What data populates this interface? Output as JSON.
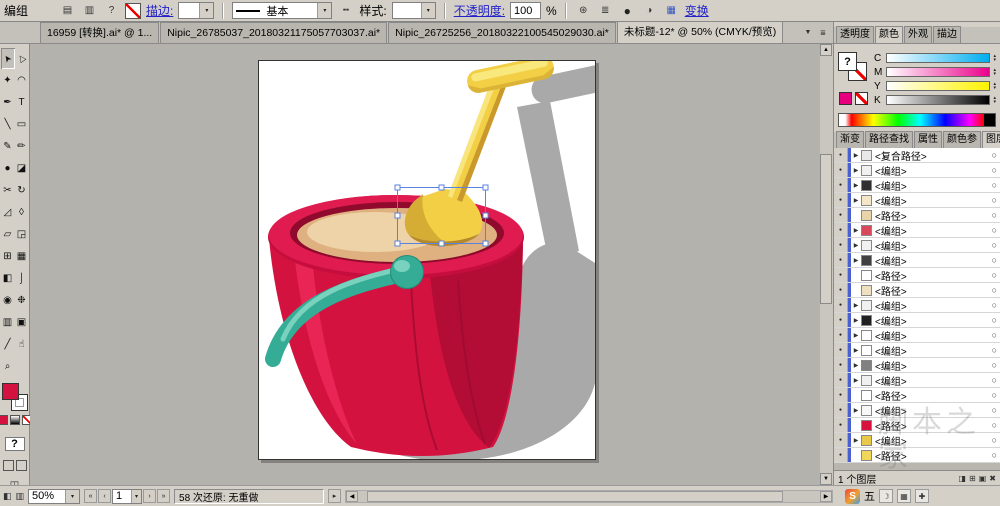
{
  "control_bar": {
    "object_label": "编组",
    "help": "?",
    "stroke_link": "描边:",
    "brush_definition": "基本",
    "style_label": "样式:",
    "opacity_link": "不透明度:",
    "opacity_value": "100",
    "percent": "%",
    "transform_link": "变换"
  },
  "document_tabs": {
    "tabs": [
      {
        "label": "16959 [转换].ai* @ 1...",
        "active": false
      },
      {
        "label": "Nipic_26785037_20180321175057703037.ai*",
        "active": false
      },
      {
        "label": "Nipic_26725256_20180322100545029030.ai*",
        "active": false
      },
      {
        "label": "未标题-12* @ 50% (CMYK/预览)",
        "active": true
      }
    ]
  },
  "toolbar": {
    "help_glyph": "?",
    "tools": [
      {
        "name": "selection-tool",
        "glyph": "➤",
        "rot": true
      },
      {
        "name": "direct-selection-tool",
        "glyph": "▷",
        "rot": true
      },
      {
        "name": "magic-wand-tool",
        "glyph": "✦"
      },
      {
        "name": "lasso-tool",
        "glyph": "◠"
      },
      {
        "name": "pen-tool",
        "glyph": "✒"
      },
      {
        "name": "type-tool",
        "glyph": "T"
      },
      {
        "name": "line-segment-tool",
        "glyph": "╲"
      },
      {
        "name": "rectangle-tool",
        "glyph": "▭"
      },
      {
        "name": "paintbrush-tool",
        "glyph": "✎"
      },
      {
        "name": "pencil-tool",
        "glyph": "✏"
      },
      {
        "name": "blob-brush-tool",
        "glyph": "●"
      },
      {
        "name": "eraser-tool",
        "glyph": "◪"
      },
      {
        "name": "scissors-tool",
        "glyph": "✂"
      },
      {
        "name": "rotate-tool",
        "glyph": "↻"
      },
      {
        "name": "scale-tool",
        "glyph": "◿"
      },
      {
        "name": "width-tool",
        "glyph": "◊"
      },
      {
        "name": "free-transform-tool",
        "glyph": "▱"
      },
      {
        "name": "shape-builder-tool",
        "glyph": "◲"
      },
      {
        "name": "perspective-grid-tool",
        "glyph": "⊞"
      },
      {
        "name": "mesh-tool",
        "glyph": "▦"
      },
      {
        "name": "gradient-tool",
        "glyph": "◧"
      },
      {
        "name": "eyedropper-tool",
        "glyph": "⌡"
      },
      {
        "name": "blend-tool",
        "glyph": "◉"
      },
      {
        "name": "symbol-sprayer-tool",
        "glyph": "❉"
      },
      {
        "name": "column-graph-tool",
        "glyph": "▥"
      },
      {
        "name": "artboard-tool",
        "glyph": "▣"
      },
      {
        "name": "slice-tool",
        "glyph": "╱"
      },
      {
        "name": "hand-tool",
        "glyph": "☝"
      },
      {
        "name": "zoom-tool",
        "glyph": "⌕"
      }
    ]
  },
  "right_dock": {
    "panel_tabs_top": {
      "tabs": [
        {
          "label": "透明度",
          "name": "tab-transparency",
          "active": false
        },
        {
          "label": "颜色",
          "name": "tab-color",
          "active": true
        },
        {
          "label": "外观",
          "name": "tab-appearance",
          "active": false
        },
        {
          "label": "描边",
          "name": "tab-stroke",
          "active": false
        }
      ]
    },
    "color_panel": {
      "fill_unknown": "?",
      "channels": [
        {
          "label": "C",
          "from": "#ffffff",
          "to": "#00aeef"
        },
        {
          "label": "M",
          "from": "#ffffff",
          "to": "#ec008c"
        },
        {
          "label": "Y",
          "from": "#ffffff",
          "to": "#fff200"
        },
        {
          "label": "K",
          "from": "#ffffff",
          "to": "#000000"
        }
      ],
      "last_color": "#e6007e"
    },
    "panel_tabs_mid": {
      "tabs": [
        {
          "label": "渐变",
          "name": "tab-gradient",
          "active": false
        },
        {
          "label": "路径查找",
          "name": "tab-pathfinder",
          "active": false
        },
        {
          "label": "属性",
          "name": "tab-attributes",
          "active": false
        },
        {
          "label": "颜色参",
          "name": "tab-color-guide",
          "active": false
        },
        {
          "label": "图层",
          "name": "tab-layers",
          "active": true
        }
      ]
    },
    "layers_panel": {
      "status": "1 个图层",
      "rows": [
        {
          "label": "<复合路径>",
          "thumb": "#e8e8e8",
          "group": true
        },
        {
          "label": "<编组>",
          "thumb": "#f0f0f0",
          "group": true
        },
        {
          "label": "<编组>",
          "thumb": "#303030",
          "group": true
        },
        {
          "label": "<编组>",
          "thumb": "#f5e6c8",
          "group": true
        },
        {
          "label": "<路径>",
          "thumb": "#e9d3a8",
          "group": false
        },
        {
          "label": "<编组>",
          "thumb": "#d84a5a",
          "group": true
        },
        {
          "label": "<编组>",
          "thumb": "#f0f0f0",
          "group": true
        },
        {
          "label": "<编组>",
          "thumb": "#404040",
          "group": true
        },
        {
          "label": "<路径>",
          "thumb": "#ffffff",
          "group": false
        },
        {
          "label": "<路径>",
          "thumb": "#efe0c0",
          "group": false
        },
        {
          "label": "<编组>",
          "thumb": "#f0f0f0",
          "group": true
        },
        {
          "label": "<编组>",
          "thumb": "#202020",
          "group": true
        },
        {
          "label": "<编组>",
          "thumb": "#ffffff",
          "group": true
        },
        {
          "label": "<编组>",
          "thumb": "#ffffff",
          "group": true
        },
        {
          "label": "<编组>",
          "thumb": "#808080",
          "group": true
        },
        {
          "label": "<编组>",
          "thumb": "#f0f0f0",
          "group": true
        },
        {
          "label": "<路径>",
          "thumb": "#ffffff",
          "group": false
        },
        {
          "label": "<编组>",
          "thumb": "#f8f8f8",
          "group": true
        },
        {
          "label": "<路径>",
          "thumb": "#d8123f",
          "group": false
        },
        {
          "label": "<编组>",
          "thumb": "#e8c84a",
          "group": true
        },
        {
          "label": "<路径>",
          "thumb": "#f0d65a",
          "group": false
        }
      ]
    }
  },
  "status_bar": {
    "zoom": "50%",
    "artboard_number": "1",
    "undo_status": "58 次还原: 无重做"
  },
  "taskbar": {
    "ime_initial": "S",
    "ime_mode": "五"
  },
  "watermark": "脚本之家",
  "icons": {
    "dropdown": "▾",
    "spinner_up": "▴",
    "spinner_down": "▾",
    "eye": "●",
    "target": "○",
    "expand": "▶",
    "menu": "≣",
    "tab_overflow": "▼",
    "scroll_left": "◀",
    "scroll_right": "▶",
    "scroll_up": "▲",
    "scroll_down": "▼",
    "nav_first": "«",
    "nav_prev": "‹",
    "nav_next": "›",
    "nav_last": "»",
    "status_more": "▸"
  },
  "colors": {
    "selection_blue": "#5a82e0",
    "bucket_red": "#d4123f",
    "bucket_dark_red": "#b30d36",
    "rim_red": "#c60e3e",
    "sand": "#dfb180",
    "sand_light": "#eed2a8",
    "shovel_yellow": "#f2cf45",
    "shovel_dark": "#c9992d",
    "teal": "#35ac96",
    "teal_light": "#7fd6c2",
    "shadow_gray": "#a9a9a9",
    "last_color": "#e6007e"
  }
}
